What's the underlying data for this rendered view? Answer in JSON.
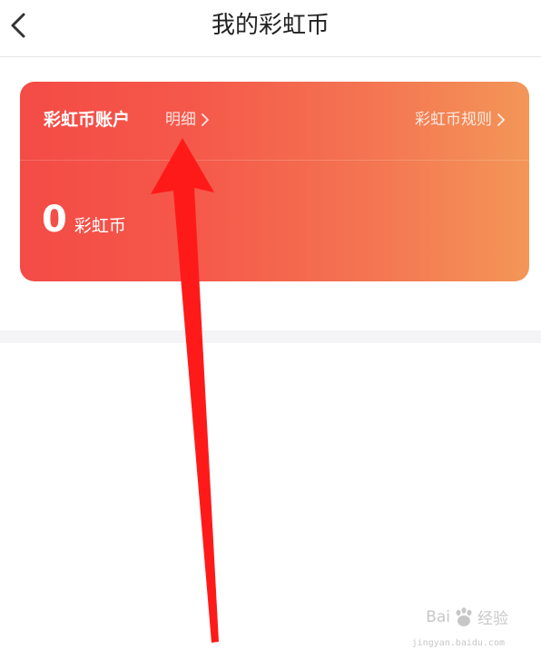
{
  "header": {
    "title": "我的彩虹币"
  },
  "card": {
    "title": "彩虹币账户",
    "detail_label": "明细",
    "rules_label": "彩虹币规则",
    "balance_value": "0",
    "balance_unit": "彩虹币",
    "colors": {
      "gradient_start": "#f44b46",
      "gradient_end": "#f39658"
    }
  },
  "annotation": {
    "arrow_color": "#ff1a1a"
  },
  "watermark": {
    "brand_left": "Bai",
    "brand_right": "经验",
    "url": "jingyan.baidu.com"
  },
  "icons": {
    "back": "chevron-left-icon",
    "detail_chevron": "chevron-right-icon",
    "rules_chevron": "chevron-right-icon",
    "watermark_paw": "paw-icon"
  }
}
